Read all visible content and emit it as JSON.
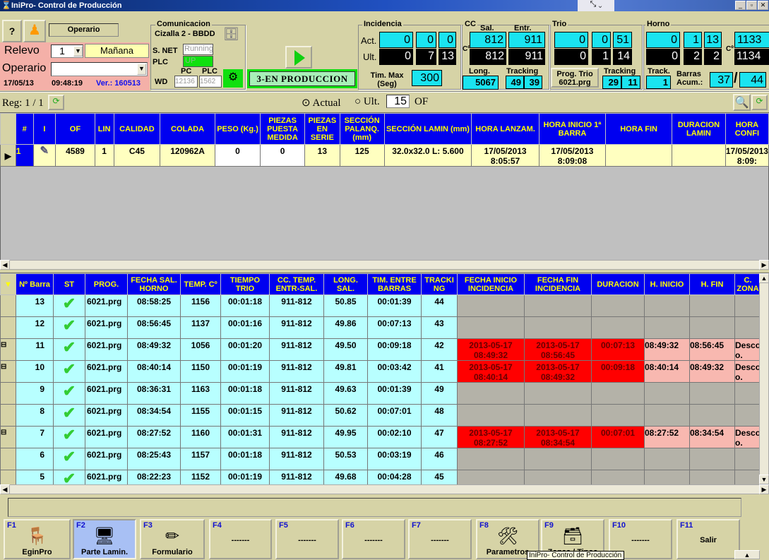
{
  "window": {
    "title": "IniPro- Control de Producción",
    "controls": [
      "_",
      "▫",
      "✕"
    ]
  },
  "header": {
    "operario_label": "Operario",
    "relevo_label": "Relevo",
    "relevo_value": "1",
    "turno": "Mañana",
    "operario_field_label": "Operario",
    "operario_value": "",
    "date": "17/05/13",
    "time": "09:48:19",
    "version": "Ver.: 160513",
    "comunicacion": {
      "legend": "Comunicacion",
      "name": "Cizalla 2 - BBDD",
      "snet_label": "S. NET",
      "snet_value": "Running",
      "plc_label": "PLC",
      "plc_value": "UP",
      "pc_label": "PC",
      "plc2_label": "PLC",
      "wd_label": "WD",
      "wd_pc": "12136",
      "wd_plc": "1562"
    },
    "estado": "3-EN PRODUCCION",
    "incidencia": {
      "legend": "Incidencia",
      "act_label": "Act.",
      "ult_label": "Ult.",
      "act": [
        "0",
        "0",
        "0"
      ],
      "ult": [
        "0",
        "7",
        "13"
      ],
      "timmax_label": "Tim. Max (Seg)",
      "timmax": "300"
    },
    "cc": {
      "legend": "CC",
      "sal_label": "Sal.",
      "entr_label": "Entr.",
      "c_label": "Cº",
      "act": [
        "812",
        "911"
      ],
      "ult": [
        "812",
        "911"
      ],
      "long_label": "Long.",
      "long": "5067",
      "tracking_label": "Tracking",
      "tracking": [
        "49",
        "39"
      ]
    },
    "trio": {
      "legend": "Trio",
      "act": [
        "0",
        "0",
        "51"
      ],
      "ult": [
        "0",
        "1",
        "14"
      ],
      "prog_label": "Prog. Trio",
      "prog_value": "6021.prg",
      "tracking_label": "Tracking",
      "tracking": [
        "29",
        "11"
      ]
    },
    "horno": {
      "legend": "Horno",
      "act": [
        "0",
        "1",
        "13"
      ],
      "ult": [
        "0",
        "2",
        "2"
      ],
      "c_label": "Cº",
      "temp": [
        "1133",
        "1134"
      ],
      "track_label": "Track.",
      "track": "1",
      "barras_label": "Barras Acum.:",
      "barras": [
        "37",
        "44"
      ]
    }
  },
  "filter": {
    "reg": "Reg: 1 / 1",
    "actual": "Actual",
    "ult": "Ult.",
    "ult_value": "15",
    "of": "OF",
    "selected": "Actual"
  },
  "orders": {
    "columns": [
      "#",
      "I",
      "OF",
      "LIN",
      "CALIDAD",
      "COLADA",
      "PESO (Kg.)",
      "PIEZAS PUESTA MEDIDA",
      "PIEZAS EN SERIE",
      "SECCIÓN PALANQ. (mm)",
      "SECCIÓN LAMIN (mm)",
      "HORA LANZAM.",
      "HORA INICIO 1ª BARRA",
      "HORA FIN",
      "DURACION LAMIN",
      "HORA CONFI"
    ],
    "rows": [
      [
        "1",
        "",
        "4589",
        "1",
        "C45",
        "120962A",
        "0",
        "0",
        "13",
        "125",
        "32.0x32.0 L: 5.600",
        "17/05/2013 8:05:57",
        "17/05/2013 8:09:08",
        "",
        "",
        "17/05/2013 8:09:"
      ]
    ]
  },
  "bars": {
    "columns": [
      "Nº Barra",
      "ST",
      "PROG.",
      "FECHA SAL. HORNO",
      "TEMP. Cº",
      "TIEMPO TRIO",
      "CC. TEMP. ENTR-SAL.",
      "LONG. SAL.",
      "TIM. ENTRE BARRAS",
      "TRACKI NG",
      "FECHA INICIO INCIDENCIA",
      "FECHA FIN INCIDENCIA",
      "DURACION",
      "H. INICIO",
      "H. FIN",
      "C. ZONA"
    ],
    "rows": [
      [
        "13",
        "ok",
        "6021.prg",
        "08:58:25",
        "1156",
        "00:01:18",
        "911-812",
        "50.85",
        "00:01:39",
        "44",
        "",
        "",
        "",
        "",
        "",
        ""
      ],
      [
        "12",
        "ok",
        "6021.prg",
        "08:56:45",
        "1137",
        "00:01:16",
        "911-812",
        "49.86",
        "00:07:13",
        "43",
        "",
        "",
        "",
        "",
        "",
        ""
      ],
      [
        "11",
        "ok",
        "6021.prg",
        "08:49:32",
        "1056",
        "00:01:20",
        "911-812",
        "49.50",
        "00:09:18",
        "42",
        "2013-05-17 08:49:32",
        "2013-05-17 08:56:45",
        "00:07:13",
        "08:49:32",
        "08:56:45",
        "Desco o."
      ],
      [
        "10",
        "ok",
        "6021.prg",
        "08:40:14",
        "1150",
        "00:01:19",
        "911-812",
        "49.81",
        "00:03:42",
        "41",
        "2013-05-17 08:40:14",
        "2013-05-17 08:49:32",
        "00:09:18",
        "08:40:14",
        "08:49:32",
        "Desco o."
      ],
      [
        "9",
        "ok",
        "6021.prg",
        "08:36:31",
        "1163",
        "00:01:18",
        "911-812",
        "49.63",
        "00:01:39",
        "49",
        "",
        "",
        "",
        "",
        "",
        ""
      ],
      [
        "8",
        "ok",
        "6021.prg",
        "08:34:54",
        "1155",
        "00:01:15",
        "911-812",
        "50.62",
        "00:07:01",
        "48",
        "",
        "",
        "",
        "",
        "",
        ""
      ],
      [
        "7",
        "ok",
        "6021.prg",
        "08:27:52",
        "1160",
        "00:01:31",
        "911-812",
        "49.95",
        "00:02:10",
        "47",
        "2013-05-17 08:27:52",
        "2013-05-17 08:34:54",
        "00:07:01",
        "08:27:52",
        "08:34:54",
        "Desco o."
      ],
      [
        "6",
        "ok",
        "6021.prg",
        "08:25:43",
        "1157",
        "00:01:18",
        "911-812",
        "50.53",
        "00:03:19",
        "46",
        "",
        "",
        "",
        "",
        "",
        ""
      ],
      [
        "5",
        "ok",
        "6021.prg",
        "08:22:23",
        "1152",
        "00:01:19",
        "911-812",
        "49.68",
        "00:04:28",
        "45",
        "",
        "",
        "",
        "",
        "",
        ""
      ]
    ]
  },
  "status_text": "",
  "fkeys": [
    {
      "key": "F1",
      "label": "EginPro",
      "icon": "chair-icon"
    },
    {
      "key": "F2",
      "label": "Parte Lamin.",
      "icon": "monitor-icon",
      "active": true
    },
    {
      "key": "F3",
      "label": "Formulario",
      "icon": "pencil-icon"
    },
    {
      "key": "F4",
      "label": "-------"
    },
    {
      "key": "F5",
      "label": "-------"
    },
    {
      "key": "F6",
      "label": "-------"
    },
    {
      "key": "F7",
      "label": "-------"
    },
    {
      "key": "F8",
      "label": "Parametros",
      "icon": "tools-icon"
    },
    {
      "key": "F9",
      "label": "Zonas / Tipos",
      "icon": "database-icon"
    },
    {
      "key": "F10",
      "label": "-------"
    },
    {
      "key": "F11",
      "label": "Salir"
    }
  ],
  "tooltip": "IniPro- Control de Producción",
  "colors": {
    "header_bg": "#0000f0",
    "header_text": "#ffff00",
    "row_cyan": "#b8ffff",
    "incident_red": "#ff0000",
    "incident_pink": "#f8b8b0",
    "counter_cyan": "#1ae4f0"
  }
}
